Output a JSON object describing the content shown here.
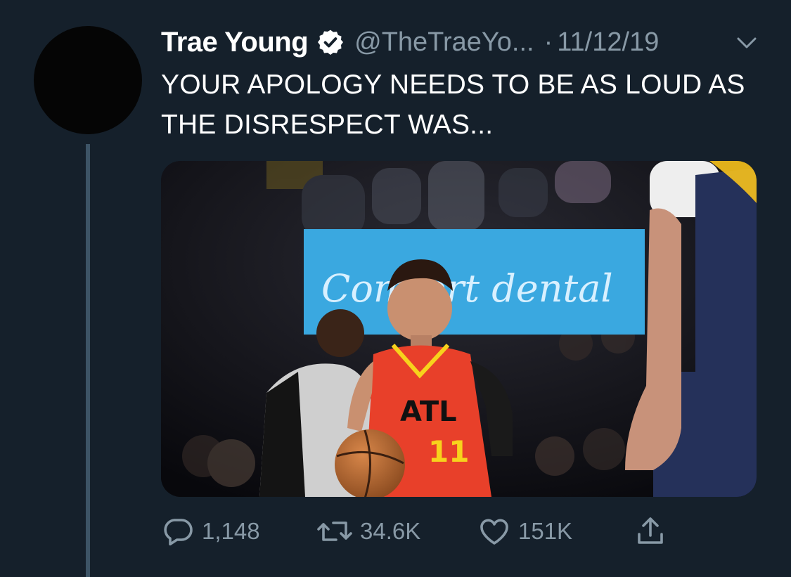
{
  "tweet": {
    "author_name": "Trae Young",
    "handle": "@TheTraeYo...",
    "separator": "·",
    "date": "11/12/19",
    "text": "YOUR APOLOGY NEEDS TO BE AS LOUD AS THE DISRESPECT WAS...",
    "verified": true
  },
  "media": {
    "jersey_text": "ATL",
    "jersey_number": "11",
    "banner_text": "Comfort dental"
  },
  "actions": {
    "replies": "1,148",
    "retweets": "34.6K",
    "likes": "151K"
  },
  "icons": {
    "verified": "verified-badge-icon",
    "more": "chevron-down-icon",
    "reply": "reply-bubble-icon",
    "retweet": "retweet-arrows-icon",
    "like": "heart-icon",
    "share": "share-upload-icon"
  },
  "colors": {
    "background": "#15202b",
    "secondary_text": "#8899a6",
    "thread_line": "#3d5466",
    "jersey_red": "#e8402a"
  }
}
